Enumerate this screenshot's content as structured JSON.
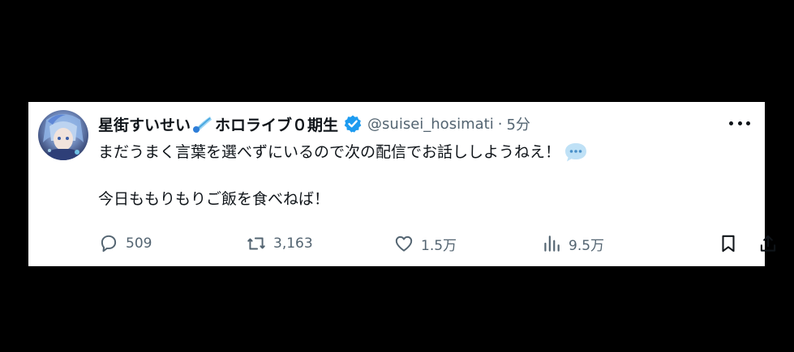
{
  "tweet": {
    "display_name_part1": "星街すいせい",
    "display_name_part2": "ホロライブ０期生",
    "handle": "@suisei_hosimati",
    "separator": "·",
    "time": "5分",
    "text_line1": "まだうまく言葉を選べずにいるので次の配信でお話ししようねえ！",
    "text_line2": "今日ももりもりご飯を食べねば！"
  },
  "actions": {
    "reply_count": "509",
    "retweet_count": "3,163",
    "like_count": "1.5万",
    "views_count": "9.5万"
  },
  "icons": {
    "verified": "verified-badge-icon",
    "comet": "comet-emoji-icon",
    "speech_bubble": "speech-bubble-emoji-icon"
  },
  "colors": {
    "background": "#000000",
    "card": "#ffffff",
    "text": "#0f1419",
    "secondary_text": "#536471",
    "verified_blue": "#1d9bf0"
  }
}
